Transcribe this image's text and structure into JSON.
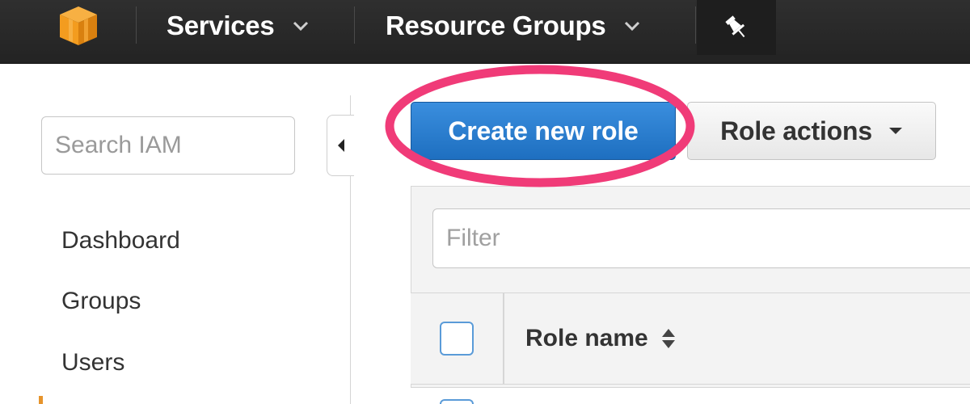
{
  "topnav": {
    "logo_icon": "aws-cube-icon",
    "services_label": "Services",
    "resource_groups_label": "Resource Groups",
    "pin_icon": "pin-icon"
  },
  "sidebar": {
    "search_placeholder": "Search IAM",
    "items": [
      {
        "label": "Dashboard"
      },
      {
        "label": "Groups"
      },
      {
        "label": "Users"
      }
    ]
  },
  "toolbar": {
    "create_role_label": "Create new role",
    "role_actions_label": "Role actions"
  },
  "table": {
    "filter_placeholder": "Filter",
    "columns": [
      {
        "label": "Role name"
      }
    ]
  },
  "colors": {
    "nav_background": "#232323",
    "primary_button": "#1e6fc0",
    "highlight_ring": "#f03b78",
    "logo_orange": "#f39c1f",
    "checkbox_border": "#5a9bd8"
  }
}
